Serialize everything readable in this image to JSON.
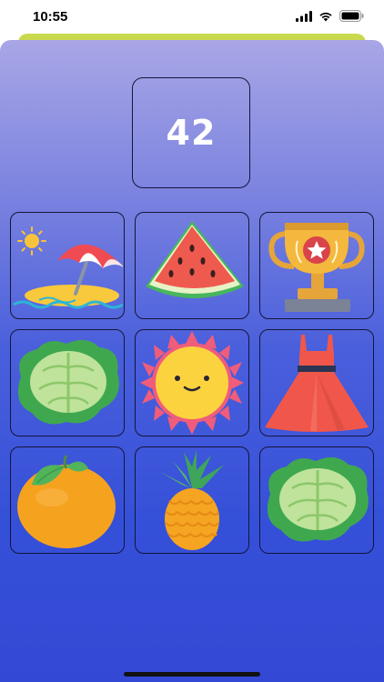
{
  "status": {
    "time": "10:55"
  },
  "game": {
    "score": "42",
    "cards": [
      {
        "icon": "beach-umbrella-icon"
      },
      {
        "icon": "watermelon-icon"
      },
      {
        "icon": "trophy-icon"
      },
      {
        "icon": "cabbage-icon"
      },
      {
        "icon": "sun-icon"
      },
      {
        "icon": "dress-icon"
      },
      {
        "icon": "orange-icon"
      },
      {
        "icon": "pineapple-icon"
      },
      {
        "icon": "cabbage-icon"
      }
    ]
  },
  "colors": {
    "background_top": "#a9a6e6",
    "background_bottom": "#3349d6",
    "accent_bar": "#c9d94e",
    "card_border": "#14163a"
  }
}
